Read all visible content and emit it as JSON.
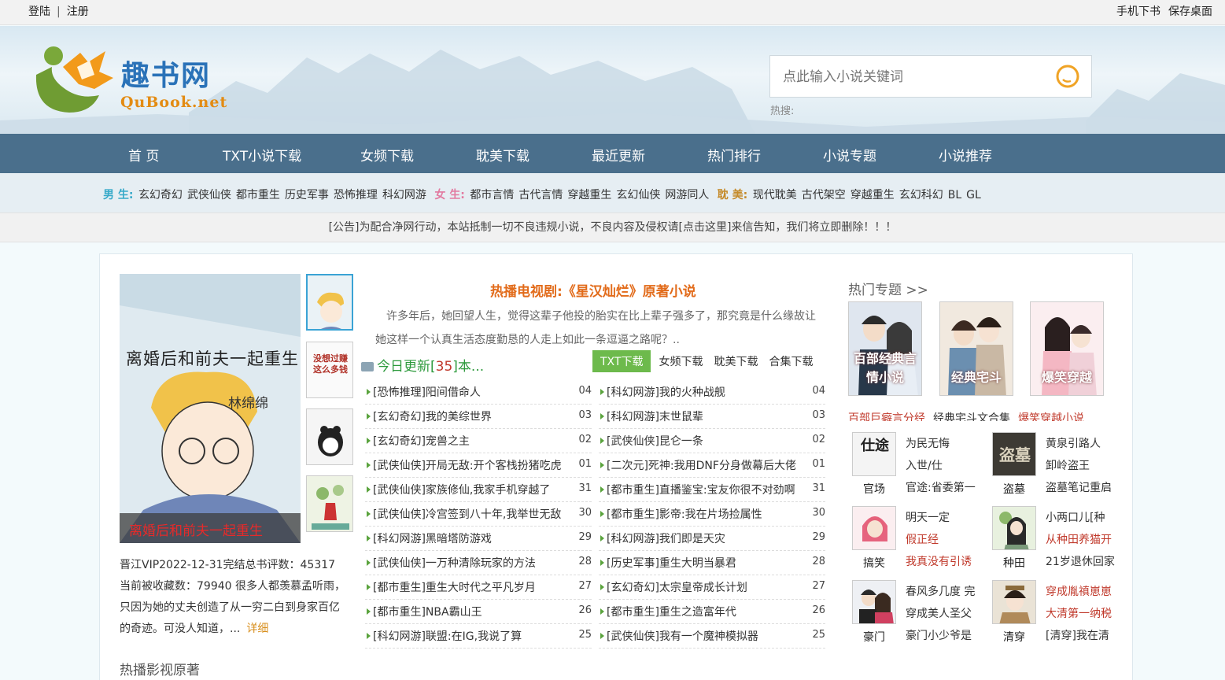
{
  "topbar": {
    "login": "登陆",
    "register": "注册",
    "mobile": "手机下书",
    "save_desktop": "保存桌面"
  },
  "logo": {
    "title": "趣书网",
    "domain": "QuBook.net"
  },
  "search": {
    "placeholder": "点此输入小说关键词",
    "hot_label": "热搜:"
  },
  "nav": [
    "首 页",
    "TXT小说下载",
    "女频下载",
    "耽美下载",
    "最近更新",
    "热门排行",
    "小说专题",
    "小说推荐"
  ],
  "categories": {
    "male_label": "男 生:",
    "male": [
      "玄幻奇幻",
      "武侠仙侠",
      "都市重生",
      "历史军事",
      "恐怖推理",
      "科幻网游"
    ],
    "female_label": "女 生:",
    "female": [
      "都市言情",
      "古代言情",
      "穿越重生",
      "玄幻仙侠",
      "网游同人"
    ],
    "danmei_label": "耽 美:",
    "danmei": [
      "现代耽美",
      "古代架空",
      "穿越重生",
      "玄幻科幻",
      "BL",
      "GL"
    ]
  },
  "notice": "[公告]为配合净网行动，本站抵制一切不良违规小说，不良内容及侵权请[点击这里]来信告知，我们将立即删除！！！",
  "featured": {
    "cover_title": "离婚后和前夫一起重生",
    "cover_author": "林绵绵",
    "cover_caption": "离婚后和前夫一起重生",
    "thumb2_text": "没想过赚这么多钱",
    "description": "晋江VIP2022-12-31完结总书评数：45317 当前被收藏数：79940 很多人都羡慕孟听雨，只因为她的丈夫创造了从一穷二白到身家百亿的奇迹。可没人知道，...",
    "more": "详细",
    "section_title": "热播影视原著"
  },
  "tv": {
    "title": "热播电视剧:《星汉灿烂》原著小说",
    "desc": "许多年后，她回望人生，觉得这辈子他投的胎实在比上辈子强多了，那究竟是什么缘故让她这样一个认真生活态度勤恳的人走上如此一条逗逼之路呢？.."
  },
  "today": {
    "prefix": "今日更新[",
    "count": "35",
    "suffix": "]本...",
    "tabs": [
      "TXT下载",
      "女频下载",
      "耽美下载",
      "合集下载"
    ]
  },
  "list_left": [
    {
      "t": "[恐怖推理]阳间借命人",
      "d": "04"
    },
    {
      "t": "[玄幻奇幻]我的美综世界",
      "d": "03"
    },
    {
      "t": "[玄幻奇幻]宠兽之主",
      "d": "02"
    },
    {
      "t": "[武侠仙侠]开局无敌:开个客栈扮猪吃虎",
      "d": "01"
    },
    {
      "t": "[武侠仙侠]家族修仙,我家手机穿越了",
      "d": "31"
    },
    {
      "t": "[武侠仙侠]冷宫签到八十年,我举世无敌",
      "d": "30"
    },
    {
      "t": "[科幻网游]黑暗塔防游戏",
      "d": "29"
    },
    {
      "t": "[武侠仙侠]一万种清除玩家的方法",
      "d": "28"
    },
    {
      "t": "[都市重生]重生大时代之平凡岁月",
      "d": "27"
    },
    {
      "t": "[都市重生]NBA霸山王",
      "d": "26"
    },
    {
      "t": "[科幻网游]联盟:在IG,我说了算",
      "d": "25"
    }
  ],
  "list_right": [
    {
      "t": "[科幻网游]我的火种战舰",
      "d": "04"
    },
    {
      "t": "[科幻网游]末世鼠辈",
      "d": "03"
    },
    {
      "t": "[武侠仙侠]昆仑一条",
      "d": "02"
    },
    {
      "t": "[二次元]死神:我用DNF分身做幕后大佬",
      "d": "01"
    },
    {
      "t": "[都市重生]直播鉴宝:宝友你很不对劲啊",
      "d": "31"
    },
    {
      "t": "[都市重生]影帝:我在片场捡属性",
      "d": "30"
    },
    {
      "t": "[科幻网游]我们即是天灾",
      "d": "29"
    },
    {
      "t": "[历史军事]重生大明当暴君",
      "d": "28"
    },
    {
      "t": "[玄幻奇幻]太宗皇帝成长计划",
      "d": "27"
    },
    {
      "t": "[都市重生]重生之造富年代",
      "d": "26"
    },
    {
      "t": "[武侠仙侠]我有一个魔神模拟器",
      "d": "25"
    }
  ],
  "topics": {
    "header": "热门专题 >>",
    "cards": [
      "百部经典言情小说",
      "经典宅斗",
      "爆笑穿越"
    ],
    "links": [
      "百部巨癖言分经",
      "经典宅斗文合集",
      "爆笑穿越小说"
    ]
  },
  "small_cards": [
    {
      "label": "官场",
      "img_text": "仕途",
      "l1": "为民无悔",
      "l2": "入世/仕",
      "l3": "官途:省委第一"
    },
    {
      "label": "盗墓",
      "img_text": "盗墓",
      "l1": "黄泉引路人",
      "l2": "卸岭盗王",
      "l3": "盗墓笔记重启"
    },
    {
      "label": "搞笑",
      "img_text": "",
      "l1": "明天一定",
      "l2": "假正经",
      "l3": "我真没有引诱"
    },
    {
      "label": "种田",
      "img_text": "",
      "l1": "小两口儿[种",
      "l2": "从种田养猫开",
      "l3": "21岁退休回家"
    },
    {
      "label": "豪门",
      "img_text": "",
      "l1": "春风多几度 完",
      "l2": "穿成美人圣父",
      "l3": "豪门小少爷是"
    },
    {
      "label": "清穿",
      "img_text": "",
      "l1": "穿成胤禛崽崽",
      "l2": "大清第一纳税",
      "l3": "[清穿]我在清"
    }
  ],
  "colors": {
    "nav_bg": "#4a6f8c",
    "accent_orange": "#e26b1a",
    "accent_green": "#6dba4c",
    "link_red": "#c0392b"
  }
}
